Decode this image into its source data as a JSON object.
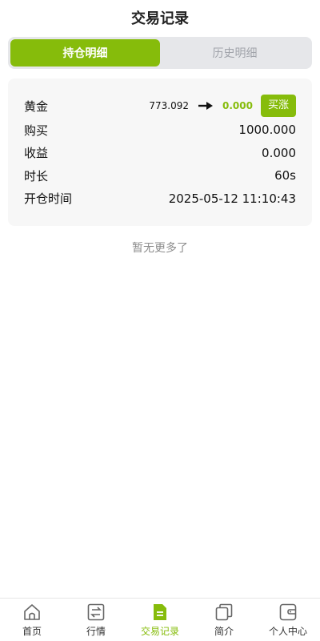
{
  "header": {
    "title": "交易记录"
  },
  "tabs": [
    {
      "label": "持仓明细",
      "active": true
    },
    {
      "label": "历史明细",
      "active": false
    }
  ],
  "position": {
    "asset": "黄金",
    "open_price": "773.092",
    "current_value": "0.000",
    "direction": "买涨",
    "rows": [
      {
        "label": "购买",
        "value": "1000.000"
      },
      {
        "label": "收益",
        "value": "0.000"
      },
      {
        "label": "时长",
        "value": "60s"
      },
      {
        "label": "开仓时间",
        "value": "2025-05-12 11:10:43"
      }
    ]
  },
  "footer_note": "暂无更多了",
  "tabbar": [
    {
      "label": "首页",
      "icon": "home-icon"
    },
    {
      "label": "行情",
      "icon": "exchange-icon"
    },
    {
      "label": "交易记录",
      "icon": "document-icon",
      "active": true
    },
    {
      "label": "简介",
      "icon": "copy-icon"
    },
    {
      "label": "个人中心",
      "icon": "wallet-icon"
    }
  ],
  "colors": {
    "accent": "#86bc0b",
    "tab_bg": "#e6e7ea",
    "card_bg": "#f7f7f7"
  }
}
